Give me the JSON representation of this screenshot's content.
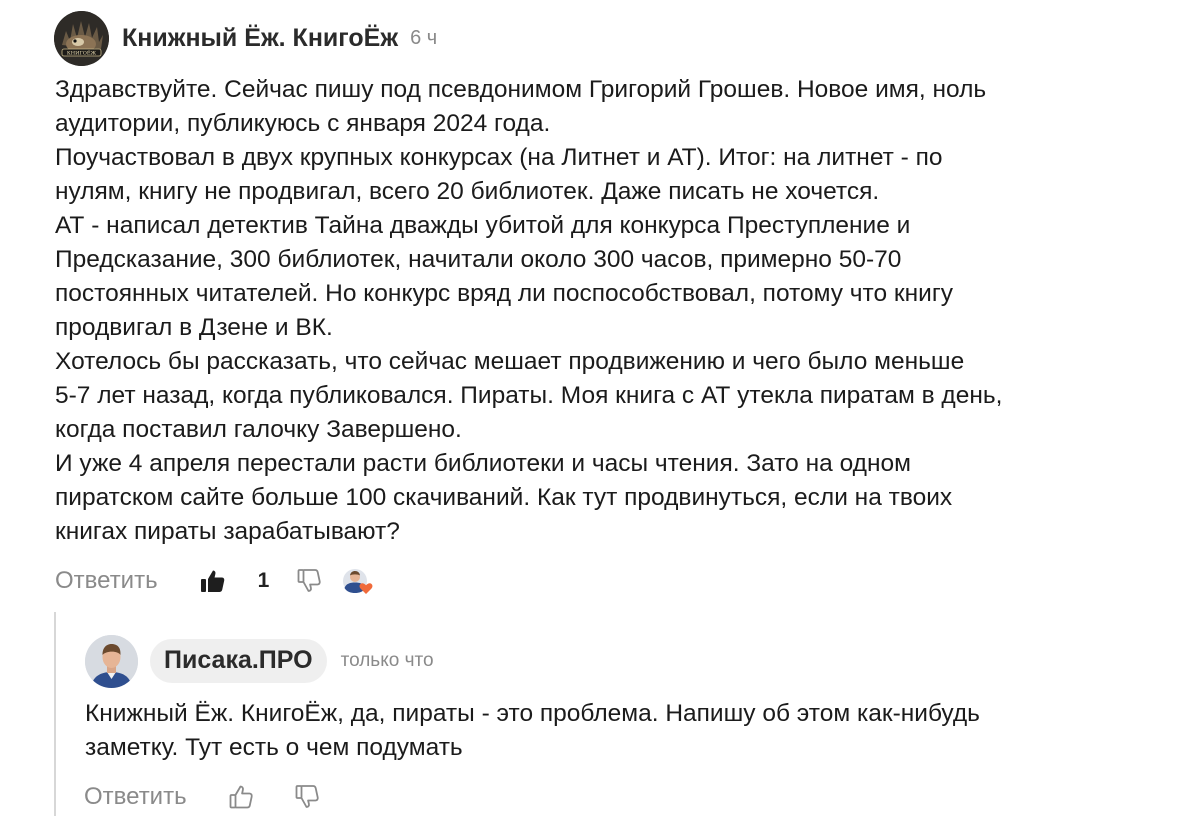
{
  "comment": {
    "author": "Книжный Ёж. КнигоЁж",
    "time": "6 ч",
    "avatar_text": "КНИГОЁЖ",
    "lines": [
      "Здравствуйте. Сейчас пишу под псевдонимом Григорий Грошев. Новое имя, ноль",
      "аудитории, публикуюсь с января 2024 года.",
      "Поучаствовал в двух крупных конкурсах (на Литнет и АТ). Итог: на литнет - по",
      "нулям, книгу не продвигал, всего 20 библиотек. Даже писать не хочется.",
      "АТ - написал детектив Тайна дважды убитой для конкурса Преступление и",
      "Предсказание, 300 библиотек, начитали около 300 часов, примерно 50-70",
      "постоянных читателей. Но конкурс вряд ли поспособствовал, потому что книгу",
      "продвигал в Дзене и ВК.",
      "Хотелось бы рассказать, что сейчас мешает продвижению и чего было меньше",
      "5-7 лет назад, когда публиковался. Пираты. Моя книга с АТ утекла пиратам в день,",
      "когда поставил галочку Завершено.",
      "И уже 4 апреля перестали расти библиотеки и часы чтения. Зато на одном",
      "пиратском сайте больше 100 скачиваний. Как тут продвинуться, если на твоих",
      "книгах пираты зарабатывают?"
    ],
    "reply_label": "Ответить",
    "like_count": "1",
    "icons": {
      "like": "thumbs-up-filled-icon",
      "dislike": "thumbs-down-icon",
      "liked_by": "author-heart-avatar"
    }
  },
  "reply": {
    "author": "Писака.ПРО",
    "time": "только что",
    "lines": [
      "Книжный Ёж. КнигоЁж, да, пираты - это проблема. Напишу об этом как-нибудь",
      "заметку. Тут есть о чем подумать"
    ],
    "reply_label": "Ответить",
    "icons": {
      "like": "thumbs-up-icon",
      "dislike": "thumbs-down-icon"
    }
  },
  "colors": {
    "muted": "#8a8a8a",
    "pill": "#efefef",
    "heart": "#f06a3a",
    "thread": "#d7d7d7"
  }
}
